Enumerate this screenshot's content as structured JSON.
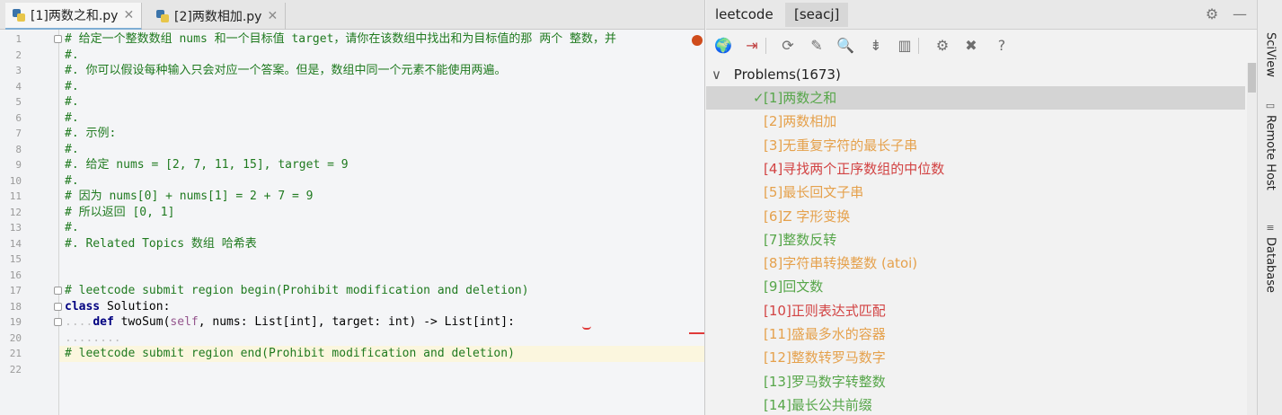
{
  "editor": {
    "tabs": [
      {
        "label": "[1]两数之和.py",
        "close": "✕",
        "active": true
      },
      {
        "label": "[2]两数相加.py",
        "close": "✕",
        "active": false
      }
    ],
    "line_numbers": [
      "1",
      "2",
      "3",
      "4",
      "5",
      "6",
      "7",
      "8",
      "9",
      "10",
      "11",
      "12",
      "13",
      "14",
      "15",
      "16",
      "17",
      "18",
      "19",
      "20",
      "21",
      "22"
    ],
    "lines": [
      [
        {
          "t": "# 给定一个整数数组 nums 和一个目标值 target，请你在该数组中找出和为目标值的那 两个 整数，并",
          "c": "cm"
        }
      ],
      [
        {
          "t": "#.",
          "c": "cm"
        }
      ],
      [
        {
          "t": "#. 你可以假设每种输入只会对应一个答案。但是，数组中同一个元素不能使用两遍。",
          "c": "cm"
        }
      ],
      [
        {
          "t": "#.",
          "c": "cm"
        }
      ],
      [
        {
          "t": "#.",
          "c": "cm"
        }
      ],
      [
        {
          "t": "#.",
          "c": "cm"
        }
      ],
      [
        {
          "t": "#. 示例:",
          "c": "cm"
        }
      ],
      [
        {
          "t": "#.",
          "c": "cm"
        }
      ],
      [
        {
          "t": "#. 给定 nums = [2, 7, 11, 15], target = 9",
          "c": "cm"
        }
      ],
      [
        {
          "t": "#.",
          "c": "cm"
        }
      ],
      [
        {
          "t": "# 因为 nums[0] + nums[1] = 2 + 7 = 9",
          "c": "cm"
        }
      ],
      [
        {
          "t": "# 所以返回 [0, 1]",
          "c": "cm"
        }
      ],
      [
        {
          "t": "#.",
          "c": "cm"
        }
      ],
      [
        {
          "t": "#. Related Topics 数组 哈希表",
          "c": "cm"
        }
      ],
      [
        {
          "t": "",
          "c": ""
        }
      ],
      [
        {
          "t": "",
          "c": ""
        }
      ],
      [
        {
          "t": "# leetcode submit region begin(Prohibit modification and deletion)",
          "c": "cm"
        }
      ],
      [
        {
          "t": "class",
          "c": "kw"
        },
        {
          "t": " Solution:",
          "c": ""
        }
      ],
      [
        {
          "t": "....",
          "c": "dots"
        },
        {
          "t": "def",
          "c": "kw"
        },
        {
          "t": " twoSum(",
          "c": ""
        },
        {
          "t": "self",
          "c": "slf"
        },
        {
          "t": ", nums: List[int], target: int) -> List[int]:",
          "c": ""
        }
      ],
      [
        {
          "t": "........",
          "c": "dots"
        }
      ],
      [
        {
          "t": "# leetcode submit region end(Prohibit modification and deletion)",
          "c": "cm"
        }
      ],
      [
        {
          "t": "",
          "c": ""
        }
      ]
    ]
  },
  "tool": {
    "tabs": [
      "leetcode",
      "[seacj]"
    ],
    "settings_icon": "gear-icon",
    "minimize_icon": "minimize-icon",
    "toolbar": [
      {
        "name": "globe-icon",
        "glyph": "🌍"
      },
      {
        "name": "login-icon",
        "glyph": "⇥"
      },
      {
        "name": "refresh-icon",
        "glyph": "⟳"
      },
      {
        "name": "magic-wand-icon",
        "glyph": "✎"
      },
      {
        "name": "search-icon",
        "glyph": "🔍"
      },
      {
        "name": "collapse-icon",
        "glyph": "⇟"
      },
      {
        "name": "chart-icon",
        "glyph": "▥"
      },
      {
        "name": "gear-icon",
        "glyph": "⚙"
      },
      {
        "name": "close-icon",
        "glyph": "✖"
      },
      {
        "name": "help-icon",
        "glyph": "?"
      }
    ],
    "root": "Problems(1673)",
    "root_chevron": "∨",
    "problems": [
      {
        "label": "[1]两数之和",
        "color": "#57a64a",
        "mark": "✓",
        "selected": true
      },
      {
        "label": "[2]两数相加",
        "color": "#e5a14c",
        "mark": "",
        "selected": false
      },
      {
        "label": "[3]无重复字符的最长子串",
        "color": "#e5a14c",
        "mark": "",
        "selected": false
      },
      {
        "label": "[4]寻找两个正序数组的中位数",
        "color": "#d24343",
        "mark": "",
        "selected": false
      },
      {
        "label": "[5]最长回文子串",
        "color": "#e5a14c",
        "mark": "",
        "selected": false
      },
      {
        "label": "[6]Z 字形变换",
        "color": "#e5a14c",
        "mark": "",
        "selected": false
      },
      {
        "label": "[7]整数反转",
        "color": "#57a64a",
        "mark": "",
        "selected": false
      },
      {
        "label": "[8]字符串转换整数 (atoi)",
        "color": "#e5a14c",
        "mark": "",
        "selected": false
      },
      {
        "label": "[9]回文数",
        "color": "#57a64a",
        "mark": "",
        "selected": false
      },
      {
        "label": "[10]正则表达式匹配",
        "color": "#d24343",
        "mark": "",
        "selected": false
      },
      {
        "label": "[11]盛最多水的容器",
        "color": "#e5a14c",
        "mark": "",
        "selected": false
      },
      {
        "label": "[12]整数转罗马数字",
        "color": "#e5a14c",
        "mark": "",
        "selected": false
      },
      {
        "label": "[13]罗马数字转整数",
        "color": "#57a64a",
        "mark": "",
        "selected": false
      },
      {
        "label": "[14]最长公共前缀",
        "color": "#57a64a",
        "mark": "",
        "selected": false
      }
    ]
  },
  "sidebar": {
    "items": [
      {
        "label": "SciView",
        "icon": "sciview-icon"
      },
      {
        "label": "Remote Host",
        "icon": "remote-host-icon"
      },
      {
        "label": "Database",
        "icon": "database-icon"
      }
    ]
  }
}
